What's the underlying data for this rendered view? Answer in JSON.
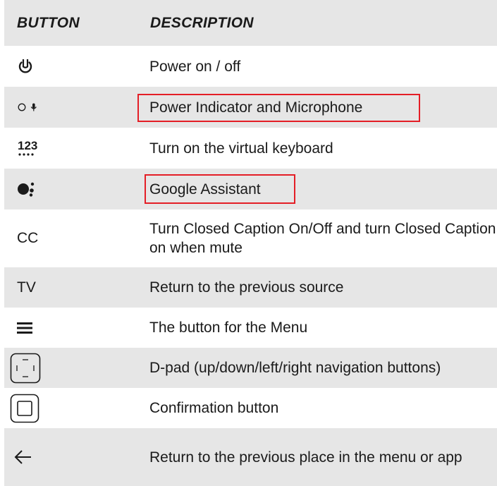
{
  "header": {
    "button": "BUTTON",
    "description": "DESCRIPTION"
  },
  "rows": [
    {
      "icon": "power-icon",
      "description": "Power on / off"
    },
    {
      "icon": "indicator-microphone-icon",
      "description": "Power Indicator and Microphone",
      "highlighted": true
    },
    {
      "icon": "numeric-keyboard-icon",
      "description": "Turn on the virtual keyboard"
    },
    {
      "icon": "google-assistant-icon",
      "description": "Google Assistant",
      "highlighted": true
    },
    {
      "button_label": "CC",
      "description": "Turn Closed Caption On/Off and turn Closed Caption on when mute"
    },
    {
      "button_label": "TV",
      "description": "Return to the previous source"
    },
    {
      "icon": "menu-icon",
      "description": "The button for the Menu"
    },
    {
      "icon": "dpad-icon",
      "description": "D-pad (up/down/left/right navigation buttons)"
    },
    {
      "icon": "confirm-icon",
      "description": "Confirmation button"
    },
    {
      "icon": "back-arrow-icon",
      "description": "Return to the previous place in the menu or app"
    }
  ],
  "colors": {
    "row_shade": "#e6e6e6",
    "highlight": "#e41e26"
  }
}
